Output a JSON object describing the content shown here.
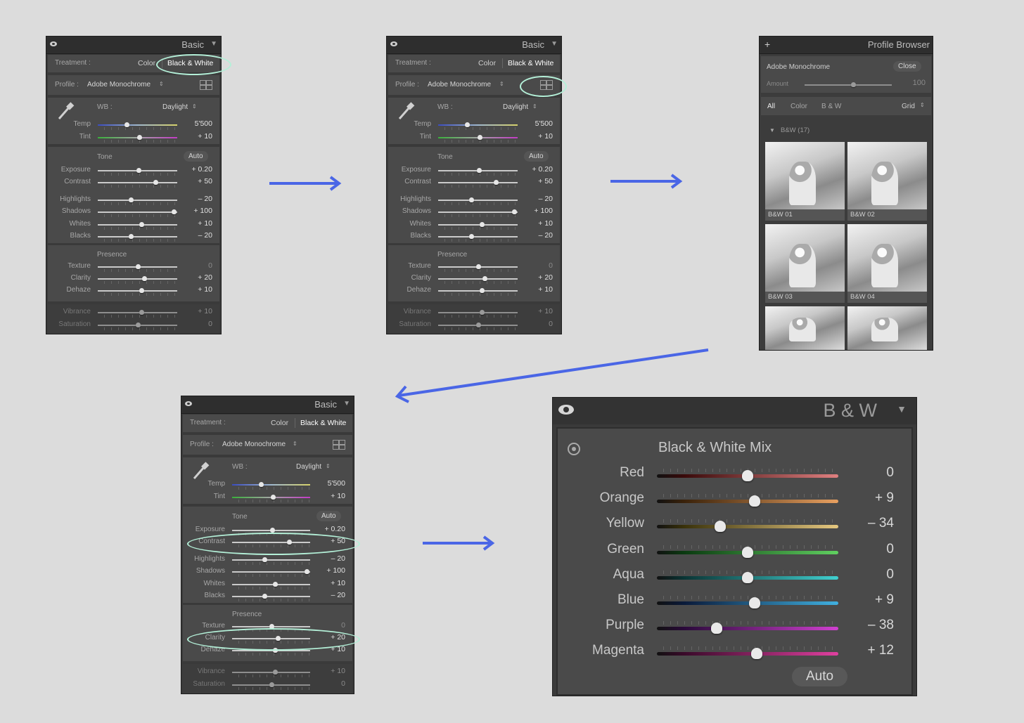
{
  "basic": {
    "title": "Basic",
    "treatment_label": "Treatment :",
    "treatment_color": "Color",
    "treatment_bw": "Black & White",
    "profile_label": "Profile :",
    "profile_value": "Adobe Monochrome",
    "wb_label": "WB :",
    "wb_value": "Daylight",
    "tone_label": "Tone",
    "auto_label": "Auto",
    "presence_label": "Presence",
    "sliders": [
      {
        "label": "Temp",
        "value": "5'500",
        "pos": 0.37
      },
      {
        "label": "Tint",
        "value": "+ 10",
        "pos": 0.53
      },
      {
        "label": "Exposure",
        "value": "+ 0.20",
        "pos": 0.52
      },
      {
        "label": "Contrast",
        "value": "+ 50",
        "pos": 0.73
      },
      {
        "label": "Highlights",
        "value": "– 20",
        "pos": 0.42
      },
      {
        "label": "Shadows",
        "value": "+ 100",
        "pos": 0.96
      },
      {
        "label": "Whites",
        "value": "+ 10",
        "pos": 0.55
      },
      {
        "label": "Blacks",
        "value": "– 20",
        "pos": 0.42
      },
      {
        "label": "Texture",
        "value": "0",
        "pos": 0.51
      },
      {
        "label": "Clarity",
        "value": "+ 20",
        "pos": 0.59
      },
      {
        "label": "Dehaze",
        "value": "+ 10",
        "pos": 0.55
      },
      {
        "label": "Vibrance",
        "value": "+ 10",
        "pos": 0.55
      },
      {
        "label": "Saturation",
        "value": "0",
        "pos": 0.51
      }
    ]
  },
  "profile_browser": {
    "title": "Profile Browser",
    "profile_name": "Adobe Monochrome",
    "close_label": "Close",
    "amount_label": "Amount",
    "amount_value": "100",
    "amount_pos": 0.56,
    "filter_all": "All",
    "filter_color": "Color",
    "filter_bw": "B & W",
    "view_label": "Grid",
    "group_label": "B&W (17)",
    "thumbs": [
      "B&W 01",
      "B&W 02",
      "B&W 03",
      "B&W 04"
    ]
  },
  "bw_panel": {
    "title": "B & W",
    "mix_title": "Black & White Mix",
    "auto_label": "Auto",
    "channels": [
      {
        "label": "Red",
        "value": "0",
        "pos": 0.5,
        "c1": "#3a0a0a",
        "c2": "#e08080"
      },
      {
        "label": "Orange",
        "value": "+ 9",
        "pos": 0.54,
        "c1": "#3a220a",
        "c2": "#e8a060"
      },
      {
        "label": "Yellow",
        "value": "– 34",
        "pos": 0.35,
        "c1": "#3a320a",
        "c2": "#e6c880"
      },
      {
        "label": "Green",
        "value": "0",
        "pos": 0.5,
        "c1": "#0a3a10",
        "c2": "#60d060"
      },
      {
        "label": "Aqua",
        "value": "0",
        "pos": 0.5,
        "c1": "#0a3535",
        "c2": "#40d0d0"
      },
      {
        "label": "Blue",
        "value": "+ 9",
        "pos": 0.54,
        "c1": "#0a1a3a",
        "c2": "#40b0e0"
      },
      {
        "label": "Purple",
        "value": "– 38",
        "pos": 0.33,
        "c1": "#2a0a3a",
        "c2": "#d040d0"
      },
      {
        "label": "Magenta",
        "value": "+ 12",
        "pos": 0.55,
        "c1": "#3a0a2a",
        "c2": "#e040a0"
      }
    ]
  },
  "colors": {
    "highlight": "#b4f0d8",
    "arrow": "#4a66e6"
  }
}
